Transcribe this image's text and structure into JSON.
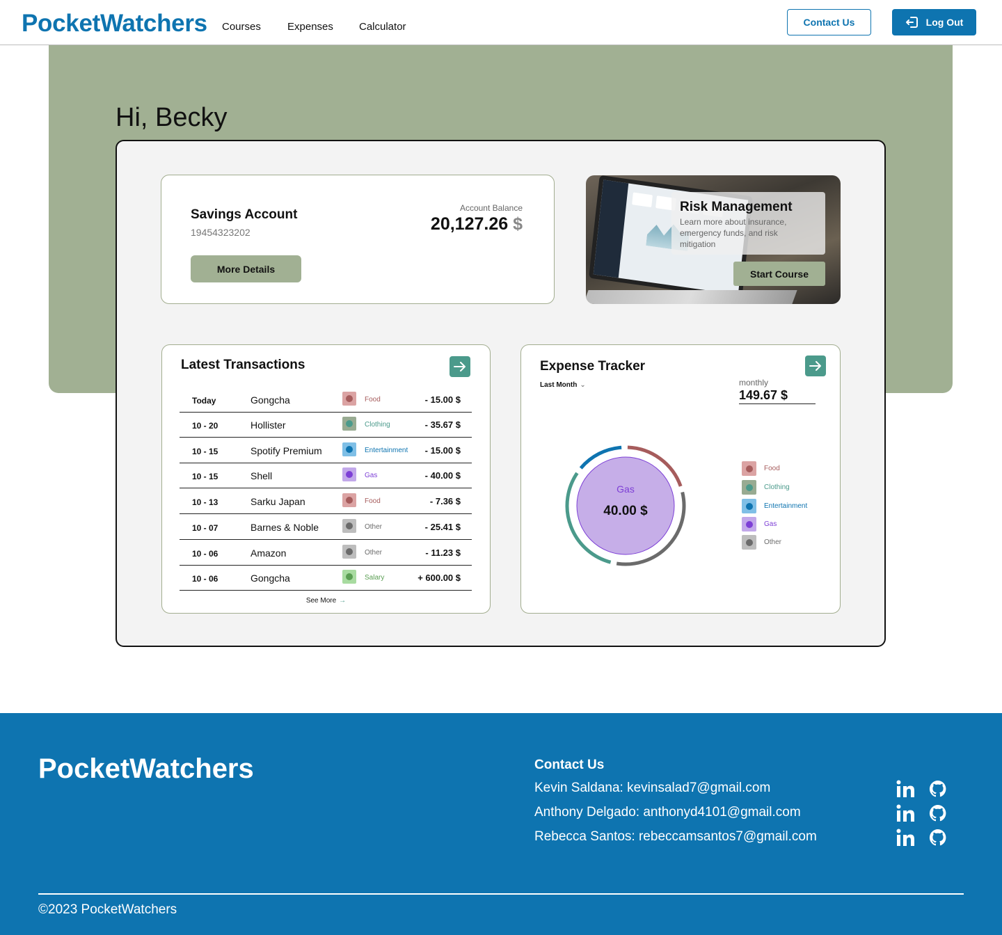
{
  "nav": {
    "logo": "PocketWatchers",
    "links": [
      "Courses",
      "Expenses",
      "Calculator"
    ],
    "contact_label": "Contact Us",
    "logout_label": "Log Out"
  },
  "greeting": "Hi, Becky",
  "savings": {
    "title": "Savings Account",
    "number": "19454323202",
    "button": "More Details",
    "balance_label": "Account Balance",
    "balance_value": "20,127.26",
    "balance_currency": "$"
  },
  "risk": {
    "title": "Risk Management",
    "description": "Learn more about insurance, emergency funds, and risk mitigation",
    "button": "Start Course"
  },
  "transactions": {
    "title": "Latest Transactions",
    "see_more": "See More",
    "rows": [
      {
        "date": "Today",
        "name": "Gongcha",
        "category": "Food",
        "amount": "- 15.00 $"
      },
      {
        "date": "10 - 20",
        "name": "Hollister",
        "category": "Clothing",
        "amount": "- 35.67 $"
      },
      {
        "date": "10 - 15",
        "name": "Spotify Premium",
        "category": "Entertainment",
        "amount": "- 15.00 $"
      },
      {
        "date": "10 - 15",
        "name": "Shell",
        "category": "Gas",
        "amount": "- 40.00 $"
      },
      {
        "date": "10 - 13",
        "name": "Sarku Japan",
        "category": "Food",
        "amount": "- 7.36 $"
      },
      {
        "date": "10 - 07",
        "name": "Barnes & Noble",
        "category": "Other",
        "amount": "- 25.41 $"
      },
      {
        "date": "10 - 06",
        "name": "Amazon",
        "category": "Other",
        "amount": "- 11.23 $"
      },
      {
        "date": "10 - 06",
        "name": "Gongcha",
        "category": "Salary",
        "amount": "+ 600.00 $"
      }
    ]
  },
  "categories": {
    "Food": {
      "bg": "#dba3a3",
      "dot": "#a65c5c",
      "text": "#a65c5c"
    },
    "Clothing": {
      "bg": "#98ab92",
      "dot": "#4b9a8b",
      "text": "#4b9a8b"
    },
    "Entertainment": {
      "bg": "#7fbfe6",
      "dot": "#0e74b0",
      "text": "#0e74b0"
    },
    "Gas": {
      "bg": "#c2a8ea",
      "dot": "#7d3fd6",
      "text": "#7d3fd6"
    },
    "Other": {
      "bg": "#bdbdbd",
      "dot": "#6b6b6b",
      "text": "#6b6b6b"
    },
    "Salary": {
      "bg": "#a8dba0",
      "dot": "#5a9e52",
      "text": "#5a9e52"
    }
  },
  "expense": {
    "title": "Expense Tracker",
    "period": "Last Month",
    "monthly_label": "monthly",
    "monthly_value": "149.67 $",
    "center_label": "Gas",
    "center_value": "40.00 $",
    "legend": [
      "Food",
      "Clothing",
      "Entertainment",
      "Gas",
      "Other"
    ],
    "segments": [
      {
        "category": "Food",
        "value": 22.36,
        "color": "#a65c5c"
      },
      {
        "category": "Other",
        "value": 36.64,
        "color": "#6b6b6b"
      },
      {
        "category": "Clothing",
        "value": 35.67,
        "color": "#4b9a8b"
      },
      {
        "category": "Entertainment",
        "value": 15.0,
        "color": "#0e74b0"
      }
    ]
  },
  "footer": {
    "logo": "PocketWatchers",
    "contact_title": "Contact Us",
    "contacts": [
      "Kevin Saldana: kevinsalad7@gmail.com",
      "Anthony Delgado: anthonyd4101@gmail.com",
      "Rebecca Santos: rebeccamsantos7@gmail.com"
    ],
    "copyright": "©2023 PocketWatchers"
  }
}
